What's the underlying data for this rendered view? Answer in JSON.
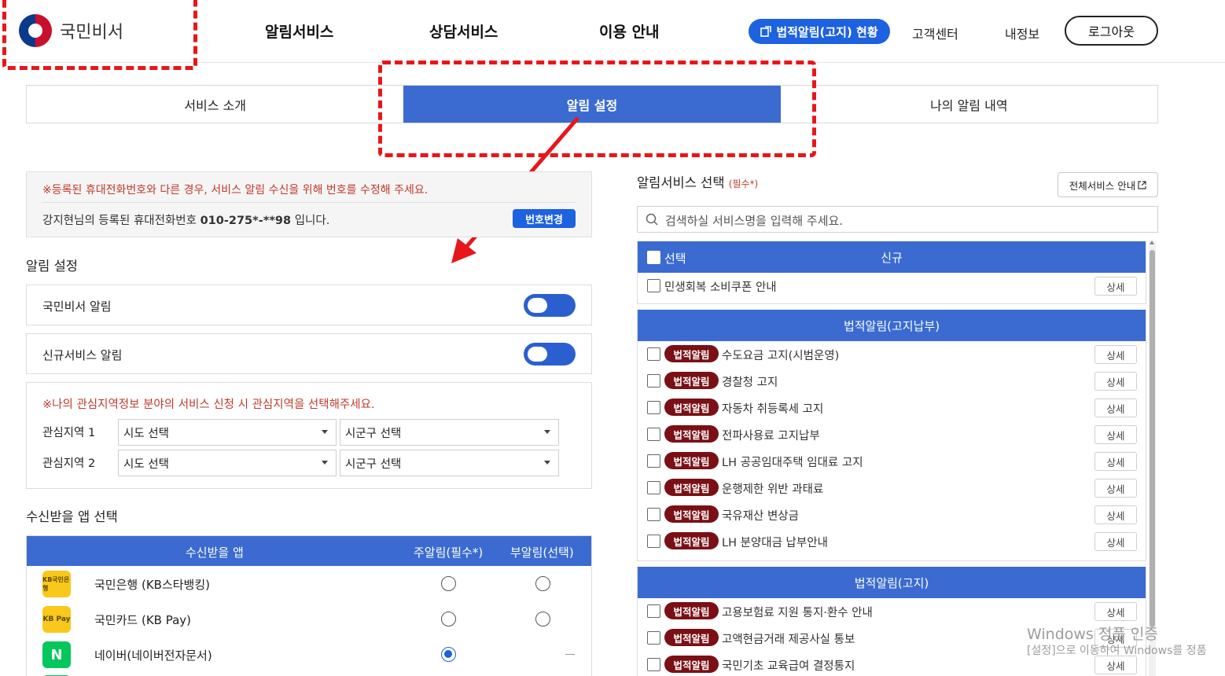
{
  "header": {
    "logo_text": "국민비서",
    "nav": [
      "알림서비스",
      "상담서비스",
      "이용 안내"
    ],
    "legal_pill": "법적알림(고지) 현황",
    "customer_center": "고객센터",
    "my_info": "내정보",
    "logout": "로그아웃"
  },
  "tabs": [
    "서비스 소개",
    "알림 설정",
    "나의 알림 내역"
  ],
  "notice": {
    "warning": "※등록된 휴대전화번호와 다른 경우, 서비스 알림 수신을 위해 번호를 수정해 주세요.",
    "phone_prefix": "강지현님의 등록된 휴대전화번호 ",
    "phone_number": "010-275*-**98",
    "phone_suffix": " 입니다.",
    "change_button": "번호변경"
  },
  "alarm_settings": {
    "title": "알림 설정",
    "toggles": [
      {
        "label": "국민비서 알림",
        "on": true
      },
      {
        "label": "신규서비스 알림",
        "on": true
      }
    ]
  },
  "region": {
    "note": "※나의 관심지역정보 분야의 서비스 신청 시 관심지역을 선택해주세요.",
    "rows": [
      {
        "label": "관심지역 1",
        "sido": "시도 선택",
        "sigungu": "시군구 선택"
      },
      {
        "label": "관심지역 2",
        "sido": "시도 선택",
        "sigungu": "시군구 선택"
      }
    ]
  },
  "app_select": {
    "title": "수신받을 앱 선택",
    "headers": [
      "수신받을 앱",
      "주알림(필수*)",
      "부알림(선택)"
    ],
    "apps": [
      {
        "name": "국민은행 (KB스타뱅킹)",
        "icon": "kb-bank-icon",
        "icon_text": "KB국민은행",
        "primary": false,
        "secondary": "radio"
      },
      {
        "name": "국민카드 (KB Pay)",
        "icon": "kb-pay-icon",
        "icon_text": "KB Pay",
        "primary": false,
        "secondary": "radio"
      },
      {
        "name": "네이버(네이버전자문서)",
        "icon": "naver-icon",
        "icon_text": "N",
        "primary": true,
        "secondary": "dash"
      }
    ]
  },
  "service_select": {
    "title": "알림서비스 선택",
    "required": "(필수*)",
    "all_services": "전체서비스 안내",
    "search_placeholder": "검색하실 서비스명을 입력해 주세요.",
    "detail_label": "상세",
    "badge_label": "법적알림",
    "new_group": {
      "select_label": "선택",
      "title": "신규",
      "items": [
        "민생회복 소비쿠폰 안내"
      ]
    },
    "groups": [
      {
        "title": "법적알림(고지납부)",
        "items": [
          "수도요금 고지(시범운영)",
          "경찰청 고지",
          "자동차 취등록세 고지",
          "전파사용료 고지납부",
          "LH 공공임대주택 임대료 고지",
          "운행제한 위반 과태료",
          "국유재산 변상금",
          "LH 분양대금 납부안내"
        ]
      },
      {
        "title": "법적알림(고지)",
        "items": [
          "고용보험료 지원 통지·환수 안내",
          "고액현금거래 제공사실 통보",
          "국민기초 교육급여 결정통지"
        ]
      }
    ]
  },
  "watermark": {
    "title": "Windows 정품 인증",
    "sub": "[설정]으로 이동하여 Windows를 정품"
  }
}
